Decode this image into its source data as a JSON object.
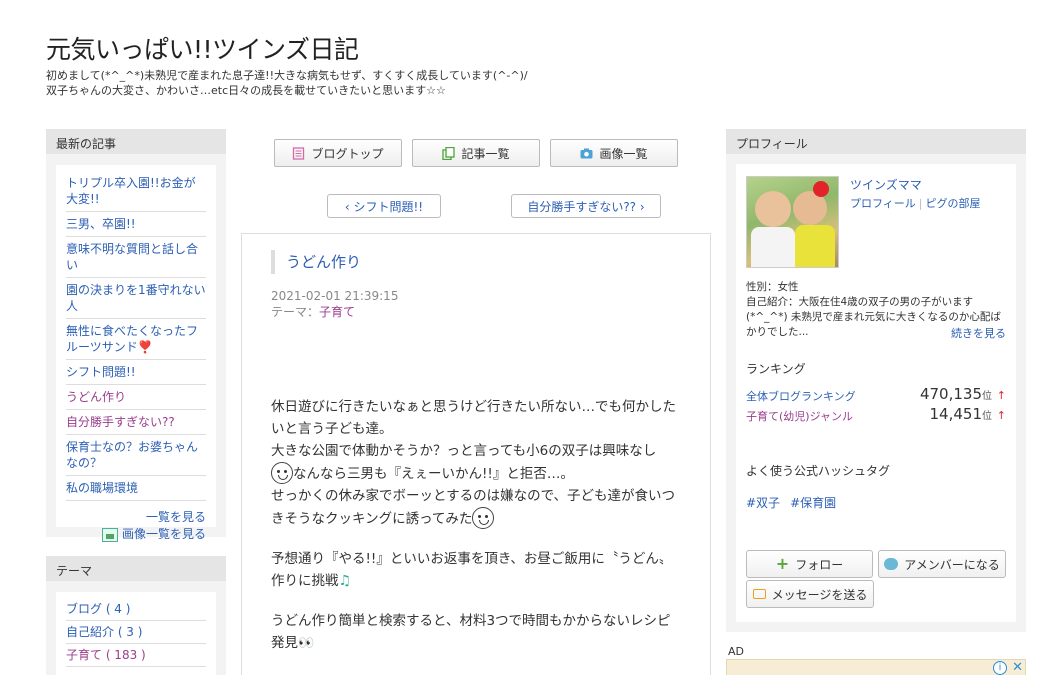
{
  "header": {
    "title": "元気いっぱい!!ツインズ日記",
    "description_line1": "初めまして(*^_^*)未熟児で産まれた息子達!!大きな病気もせず、すくすく成長しています(^-^)/",
    "description_line2": "双子ちゃんの大変さ、かわいさ…etc日々の成長を載せていきたいと思います☆☆"
  },
  "recent": {
    "heading": "最新の記事",
    "items": [
      {
        "label": "トリプル卒入園!!お金が大変!!",
        "visited": false
      },
      {
        "label": "三男、卒園!!",
        "visited": false
      },
      {
        "label": "意味不明な質問と話し合い",
        "visited": false
      },
      {
        "label": "園の決まりを1番守れない人",
        "visited": false
      },
      {
        "label": "無性に食べたくなったフルーツサンド❣️",
        "visited": false
      },
      {
        "label": "シフト問題!!",
        "visited": false
      },
      {
        "label": "うどん作り",
        "visited": true
      },
      {
        "label": "自分勝手すぎない??",
        "visited": true
      },
      {
        "label": "保育士なの？お婆ちゃんなの？",
        "visited": false
      },
      {
        "label": "私の職場環境",
        "visited": false
      }
    ],
    "more_label": "一覧を見る",
    "image_list_label": "画像一覧を見る"
  },
  "themes": {
    "heading": "テーマ",
    "items": [
      {
        "label": "ブログ ( 4 )",
        "visited": false
      },
      {
        "label": "自己紹介 ( 3 )",
        "visited": false
      },
      {
        "label": "子育て ( 183 )",
        "visited": true
      }
    ]
  },
  "nav": {
    "blog_top": "ブログトップ",
    "article_list": "記事一覧",
    "image_list": "画像一覧",
    "prev": "‹ シフト問題!!",
    "next": "自分勝手すぎない?? ›"
  },
  "entry": {
    "title": "うどん作り",
    "date": "2021-02-01 21:39:15",
    "theme_prefix": "テーマ：",
    "theme": "子育て",
    "p1_a": "休日遊びに行きたいなぁと思うけど行きたい所ない…でも何かしたいと言う子ども達。",
    "p1_b": "大きな公園で体動かそうか？っと言っても小6の双子は興味なし",
    "p1_c": "なんなら三男も『えぇーいかん!!』と拒否…。",
    "p1_d": "せっかくの休み家でボーッとするのは嫌なので、子ども達が食いつきそうなクッキングに誘ってみた",
    "p2": "予想通り『やる!!』といいお返事を頂き、お昼ご飯用に〝うどん〟作りに挑戦",
    "p3": "うどん作り簡単と検索すると、材料3つで時間もかからないレシピ発見"
  },
  "profile": {
    "heading": "プロフィール",
    "name": "ツインズママ",
    "link_profile": "プロフィール",
    "link_room": "ピグの部屋",
    "gender": "性別：女性",
    "intro": "自己紹介：大阪在住4歳の双子の男の子がいます(*^_^*) 未熟児で産まれ元気に大きくなるのか心配ばかりでした...",
    "more": "続きを見る",
    "ranking_label": "ランキング",
    "rank_all_label": "全体ブログランキング",
    "rank_all_value": "470,135",
    "rank_genre_label": "子育て(幼児)ジャンル",
    "rank_genre_value": "14,451",
    "rank_unit": "位",
    "rank_arrow": "↑",
    "hashtag_label": "よく使う公式ハッシュタグ",
    "hashtags": [
      "#双子",
      "#保育園"
    ],
    "follow": "フォロー",
    "amember": "アメンバーになる",
    "message": "メッセージを送る"
  },
  "ad": {
    "label": "AD",
    "info": "i",
    "close": "✕"
  },
  "colors": {
    "link": "#2b5fb4",
    "visited": "#9a3d8d",
    "sidebar_head_bg": "#e5e5e5",
    "sidebar_bg": "#f3f3f3"
  }
}
